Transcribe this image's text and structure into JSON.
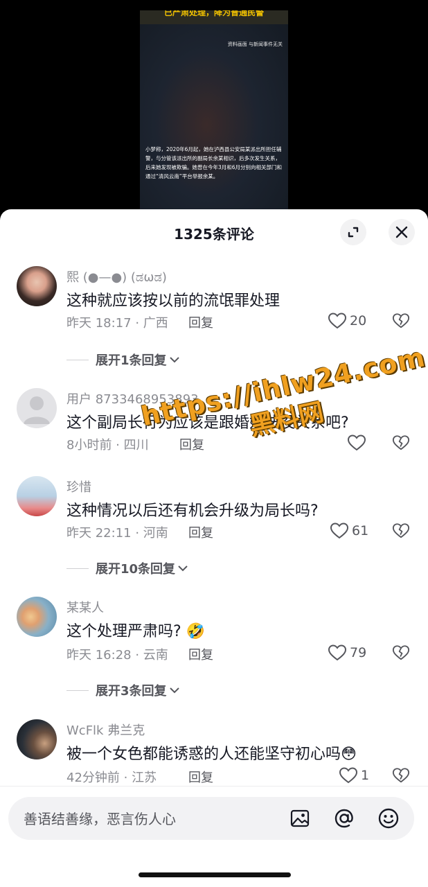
{
  "video": {
    "top_banner": "已严肃处理，降为普通民警",
    "note": "资料画面 与新闻事件无关",
    "caption": "小梦称，2020年6月起，她在泸西县公安局某派出所担任辅警，与分管该派出所的副局长余某相识，后多次发生关系，后来她发现被欺骗。她曾在今年3月和6月分别向相关部门和通过“清风云南”平台举报余某。"
  },
  "header": {
    "title": "1325条评论"
  },
  "comments": [
    {
      "username": "熙 (●—●) (ಡωಡ)",
      "text": "这种就应该按以前的流氓罪处理",
      "time_location": "昨天 18:17 · 广西",
      "reply_label": "回复",
      "likes": "20",
      "expand_label": "展开1条回复"
    },
    {
      "username": "用户 8733468953893",
      "text": "这个副局长行为应该是跟婚姻法没关系吧?",
      "time_location": "8小时前 · 四川",
      "reply_label": "回复",
      "likes": ""
    },
    {
      "username": "珍惜",
      "text": "这种情况以后还有机会升级为局长吗?",
      "time_location": "昨天 22:11 · 河南",
      "reply_label": "回复",
      "likes": "61",
      "expand_label": "展开10条回复"
    },
    {
      "username": "某某人",
      "text": "这个处理严肃吗? 🤣",
      "time_location": "昨天 16:28 · 云南",
      "reply_label": "回复",
      "likes": "79",
      "expand_label": "展开3条回复"
    },
    {
      "username": "WcFlk 弗兰克",
      "text": "被一个女色都能诱惑的人还能坚守初心吗😳",
      "time_location": "42分钟前 · 江苏",
      "reply_label": "回复",
      "likes": "1"
    }
  ],
  "input": {
    "placeholder": "善语结善缘，恶言伤人心"
  },
  "watermark": {
    "line1": "https://ihlw24.com",
    "line2": "黑料网"
  },
  "colors": {
    "text_primary": "#161823",
    "text_secondary": "#8a8b91",
    "watermark": "#f0a020"
  }
}
